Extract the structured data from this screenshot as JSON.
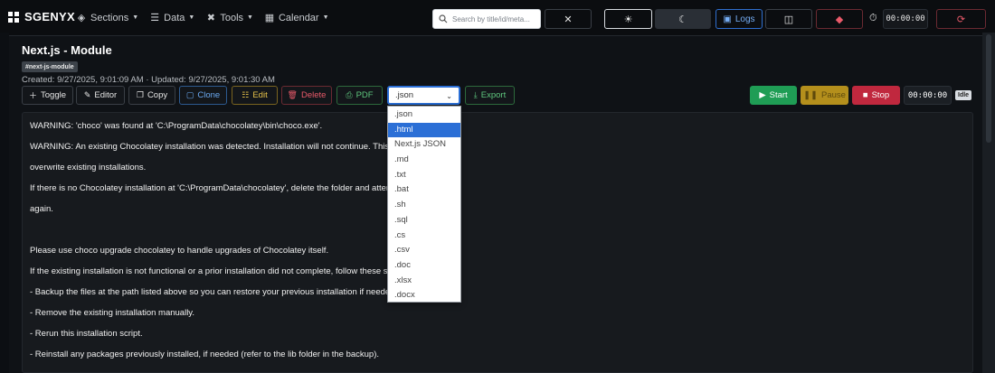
{
  "brand": {
    "name": "SGENYX"
  },
  "nav": {
    "items": [
      {
        "label": "Sections",
        "icon": "layers-icon"
      },
      {
        "label": "Data",
        "icon": "database-icon"
      },
      {
        "label": "Tools",
        "icon": "tools-icon"
      },
      {
        "label": "Calendar",
        "icon": "calendar-icon"
      }
    ],
    "search_placeholder": "Search by title/id/meta...",
    "logs_label": "Logs",
    "clock": "00:00:00"
  },
  "page": {
    "title": "Next.js - Module",
    "tag": "#next-js-module",
    "meta": "Created: 9/27/2025, 9:01:09 AM · Updated: 9/27/2025, 9:01:30 AM"
  },
  "toolbar": {
    "toggle": "Toggle",
    "editor": "Editor",
    "copy": "Copy",
    "clone": "Clone",
    "edit": "Edit",
    "delete": "Delete",
    "pdf": "PDF",
    "format_selected": ".json",
    "export": "Export"
  },
  "session": {
    "start": "Start",
    "pause": "Pause",
    "stop": "Stop",
    "timer": "00:00:00",
    "status": "Idle"
  },
  "format_options": [
    ".json",
    ".html",
    "Next.js JSON",
    ".md",
    ".txt",
    ".bat",
    ".sh",
    ".sql",
    ".cs",
    ".csv",
    ".doc",
    ".xlsx",
    ".docx"
  ],
  "format_highlighted": ".html",
  "content_lines": [
    "WARNING: 'choco' was found at 'C:\\ProgramData\\chocolatey\\bin\\choco.exe'.",
    "WARNING: An existing Chocolatey installation was detected. Installation will not continue. This scr",
    "overwrite existing installations.",
    "If there is no Chocolatey installation at 'C:\\ProgramData\\chocolatey', delete the folder and attemp",
    "again.",
    "",
    "Please use choco upgrade chocolatey to handle upgrades of Chocolatey itself.",
    "If the existing installation is not functional or a prior installation did not complete, follow these ste",
    " - Backup the files at the path listed above so you can restore your previous installation if needed.",
    " - Remove the existing installation manually.",
    " - Rerun this installation script.",
    " - Reinstall any packages previously installed, if needed (refer to the lib folder in the backup)."
  ],
  "colors": {
    "background": "#0f1216",
    "accent_blue": "#2b6fd6",
    "success_green": "#1f9d55",
    "warning_yellow": "#b48f1c",
    "danger_red": "#c0283e"
  }
}
